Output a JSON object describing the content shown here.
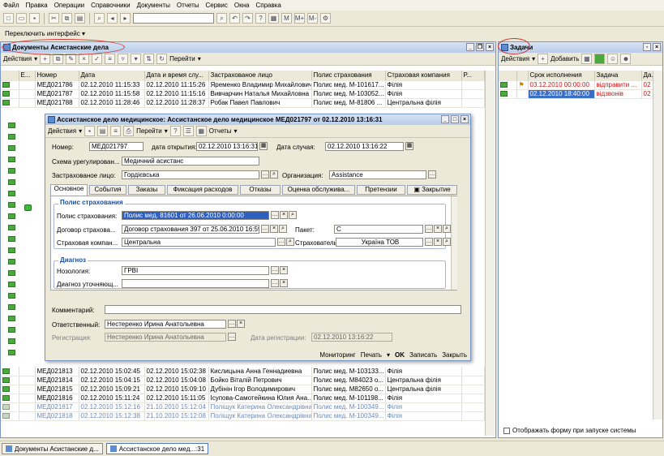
{
  "menu": [
    "Файл",
    "Правка",
    "Операции",
    "Справочники",
    "Документы",
    "Отчеты",
    "Сервис",
    "Окна",
    "Справка"
  ],
  "toolbar2": {
    "switch_interface": "Переключить интерфейс"
  },
  "list_window": {
    "title": "Документы Асистанские дела",
    "toolbar": {
      "actions": "Действия",
      "goto": "Перейти"
    },
    "columns": [
      "",
      "Е...",
      "Номер",
      "Дата",
      "Дата и время слу...",
      "Застрахованое лицо",
      "Полис страхования",
      "Страховая компания",
      "Р..."
    ],
    "rows": [
      {
        "num": "МЕД021786",
        "date": "02.12.2010 11:15:33",
        "event": "02.12.2010 11:15:26",
        "person": "Яременко Владимир Михайлович",
        "policy": "Полис мед. М-101617...",
        "company": "Філія",
        "style": "normal"
      },
      {
        "num": "МЕД021787",
        "date": "02.12.2010 11:15:58",
        "event": "02.12.2010 11:15:16",
        "person": "Вивчарчин Наталья Михайловна",
        "policy": "Полис мед. М-103052...",
        "company": "Філія",
        "style": "normal"
      },
      {
        "num": "МЕД021788",
        "date": "02.12.2010 11:28:46",
        "event": "02.12.2010 11:28:37",
        "person": "Робак Павел Павлович",
        "policy": "Полис мед. М-81806 ...",
        "company": "Центральна філія",
        "style": "normal"
      },
      {
        "num": "МЕД021813",
        "date": "02.12.2010 15:02:45",
        "event": "02.12.2010 15:02:38",
        "person": "Кислицына Анна Геннадиевна",
        "policy": "Полис мед. М-103133...",
        "company": "Філія",
        "style": "normal"
      },
      {
        "num": "МЕД021814",
        "date": "02.12.2010 15:04:15",
        "event": "02.12.2010 15:04:08",
        "person": "Бойко Віталій Петрович",
        "policy": "Полис мед. М84023 о...",
        "company": "Центральна філія",
        "style": "normal"
      },
      {
        "num": "МЕД021815",
        "date": "02.12.2010 15:09:21",
        "event": "02.12.2010 15:09:10",
        "person": "Дубінін Ігор Володимирович",
        "policy": "Полис мед. М82650 о...",
        "company": "Центральна філія",
        "style": "normal"
      },
      {
        "num": "МЕД021816",
        "date": "02.12.2010 15:11:24",
        "event": "02.12.2010 15:11:05",
        "person": "Ісупова-Самотейкина Юлия Ана...",
        "policy": "Полис мед. М-101198...",
        "company": "Філія",
        "style": "normal"
      },
      {
        "num": "МЕД021817",
        "date": "02.12.2010 15:12:16",
        "event": "21.10.2010 15:12:04",
        "person": "Поліщук Катерина Олександрівна",
        "policy": "Полис мед. М-100349...",
        "company": "Філія",
        "style": "greyed"
      },
      {
        "num": "МЕД021818",
        "date": "02.12.2010 15:12:38",
        "event": "21.10.2010 15:12:08",
        "person": "Поліщук Катерина Олександрівна",
        "policy": "Полис мед. М-100349...",
        "company": "Філія",
        "style": "greyed"
      }
    ]
  },
  "tasks_window": {
    "title": "Задачи",
    "toolbar": {
      "actions": "Действия",
      "add": "Добавить"
    },
    "columns": [
      "",
      "",
      "Срок исполнения",
      "Задача",
      "Да..."
    ],
    "rows": [
      {
        "deadline": "03.12.2010 00:00:00",
        "task": "відправити ...",
        "extra": "02",
        "style": "red"
      },
      {
        "deadline": "02.12.2010 18:40:00",
        "task": "відзвонів",
        "extra": "02",
        "style": "selected"
      }
    ],
    "show_on_start": "Отображать форму при запуске системы"
  },
  "dialog": {
    "title": "Ассистанское дело медицинское: Ассистанское дело медицинское МЕД021797 от 02.12.2010 13:16:31",
    "toolbar": {
      "actions": "Действия",
      "goto": "Перейти",
      "reports": "Отчеты"
    },
    "number_label": "Номер:",
    "number": "МЕД021797",
    "open_date_label": "дата открытия:",
    "open_date": "02.12.2010 13:16:31",
    "case_date_label": "Дата случая:",
    "case_date": "02.12.2010 13:16:22",
    "scheme_label": "Схема урегулирован...",
    "scheme": "Медичний асистанс",
    "insured_label": "Застрахованое лицо:",
    "insured": "Гордієвська",
    "org_label": "Организация:",
    "org": "Assistance",
    "tabs": [
      "Основное",
      "События",
      "Заказы",
      "Фиксация расходов",
      "Отказы",
      "Оценка обслужива...",
      "Претензии",
      "Закрытие"
    ],
    "policy_group": "Полис страхования",
    "policy_label": "Полис страхования:",
    "policy": "Полис мед.",
    "policy_rest": "81601 от 26.06.2010 0:00:00",
    "contract_label": "Договор страхова...",
    "contract": "Договор страхования 397 от 25.06.2010 16:59:4",
    "packet_label": "Пакет:",
    "packet": "С",
    "company_label": "Страховая компан...",
    "company": "Центральна",
    "insurer_label": "Страхователь:",
    "insurer": "Україна ТОВ",
    "diag_group": "Диагноз",
    "nosology_label": "Нозология:",
    "nosology": "ГРВІ",
    "diag_detail_label": "Диагноз уточняющ...",
    "diag_detail": "",
    "comment_label": "Комментарий:",
    "comment": "",
    "responsible_label": "Ответственный:",
    "responsible": "Нестеренко Ирина Анатольевна",
    "registration_label": "Регистрация:",
    "registration": "Нестеренко Ирина Анатольевна",
    "reg_date_label": "Дата регистрации:",
    "reg_date": "02.12.2010 13:16:22",
    "buttons": {
      "monitoring": "Мониторинг",
      "print": "Печать",
      "ok": "OK",
      "save": "Записать",
      "close": "Закрыть"
    }
  },
  "taskbar": [
    "Документы Асистанские д...",
    "Ассистанское дело мед...:31"
  ]
}
